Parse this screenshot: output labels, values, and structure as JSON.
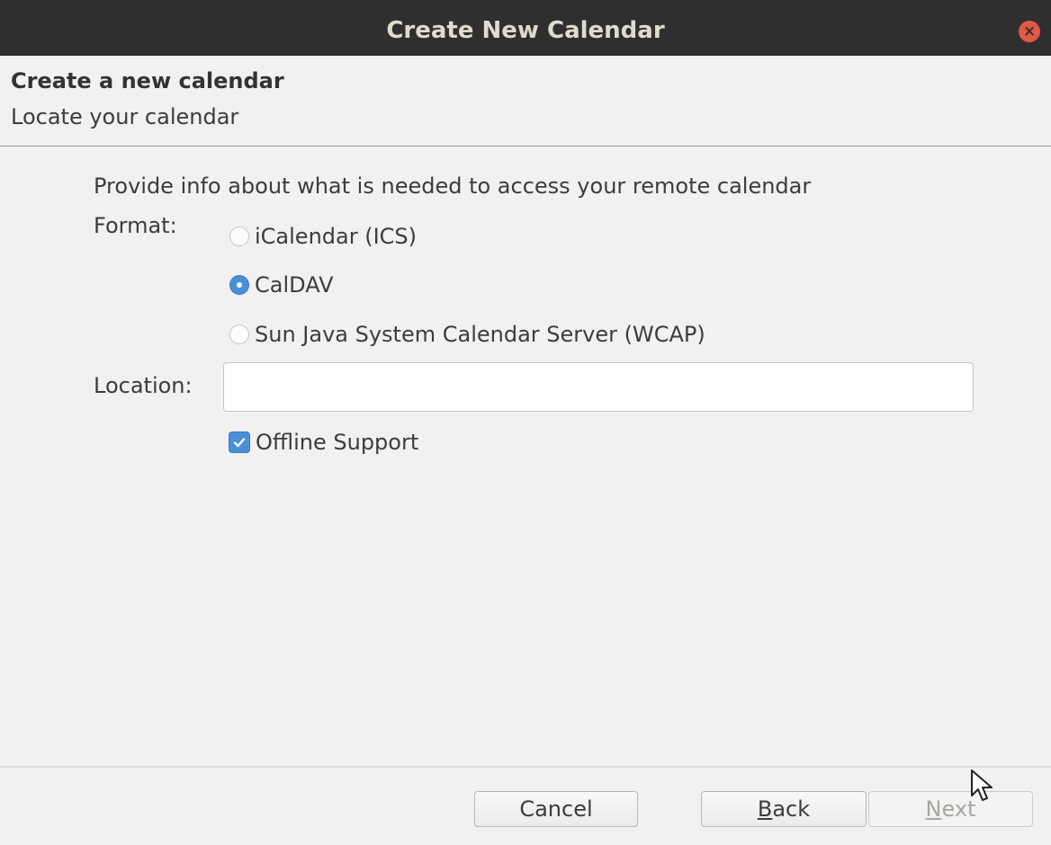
{
  "window": {
    "title": "Create New Calendar"
  },
  "header": {
    "title": "Create a new calendar",
    "subtitle": "Locate your calendar"
  },
  "form": {
    "instruction": "Provide info about what is needed to access your remote calendar",
    "format_label": "Format:",
    "format_options": [
      {
        "label": "iCalendar (ICS)",
        "checked": false
      },
      {
        "label": "CalDAV",
        "checked": true
      },
      {
        "label": "Sun Java System Calendar Server (WCAP)",
        "checked": false
      }
    ],
    "location_label": "Location:",
    "location_value": "",
    "offline_support_label": "Offline Support",
    "offline_support_checked": true
  },
  "footer": {
    "cancel_label": "Cancel",
    "back_label_first": "B",
    "back_label_rest": "ack",
    "next_label_first": "N",
    "next_label_rest": "ext",
    "next_disabled": true
  },
  "colors": {
    "titlebar": "#2f2f2f",
    "accent": "#4a90d9",
    "close": "#e05a47"
  }
}
